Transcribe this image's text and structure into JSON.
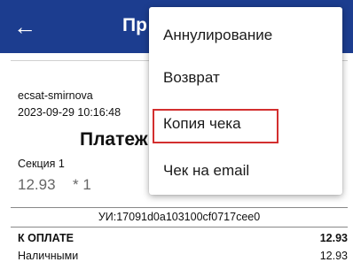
{
  "appbar": {
    "back_icon": "arrow-left-icon",
    "title": "Пр"
  },
  "receipt": {
    "user": "ecsat-smirnova",
    "datetime": "2023-09-29 10:16:48",
    "heading": "Платеж",
    "section": "Секция 1",
    "price": "12.93",
    "quantity": "* 1",
    "uid": "УИ:17091d0a103100cf0717cee0",
    "due_label": "К ОПЛАТЕ",
    "due_value": "12.93",
    "cash_label": "Наличными",
    "cash_value": "12.93"
  },
  "menu": {
    "items": [
      {
        "label": "Аннулирование"
      },
      {
        "label": "Возврат"
      },
      {
        "label": "Копия чека",
        "highlighted": true
      },
      {
        "label": "Чек на email"
      }
    ]
  },
  "colors": {
    "appbar": "#1c3d8f",
    "highlight": "#d32f2f"
  }
}
